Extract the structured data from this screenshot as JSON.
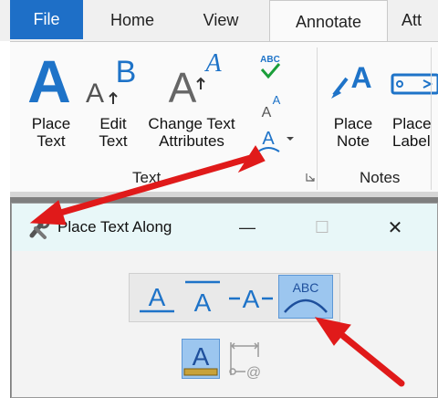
{
  "tabs": {
    "file": "File",
    "home": "Home",
    "view": "View",
    "annotate": "Annotate",
    "att": "Att"
  },
  "ribbon": {
    "text_group": {
      "label": "Text",
      "place_text": [
        "Place",
        "Text"
      ],
      "edit_text": [
        "Edit",
        "Text"
      ],
      "change_attrs": [
        "Change Text",
        "Attributes"
      ]
    },
    "notes_group": {
      "label": "Notes",
      "place_note": [
        "Place",
        "Note"
      ],
      "place_label": [
        "Place",
        "Label"
      ]
    }
  },
  "dialog": {
    "title": "Place Text Along",
    "minimize_glyph": "—",
    "maximize_glyph": "☐",
    "close_glyph": "✕"
  },
  "icons": {
    "abc_small": "ABC",
    "abc_arc": "ABC"
  },
  "colors": {
    "file_tab": "#1e6fc7",
    "accent_blue": "#1e73c8",
    "arrow_red": "#e01a1a",
    "selected_bg": "#9cc6ef"
  }
}
